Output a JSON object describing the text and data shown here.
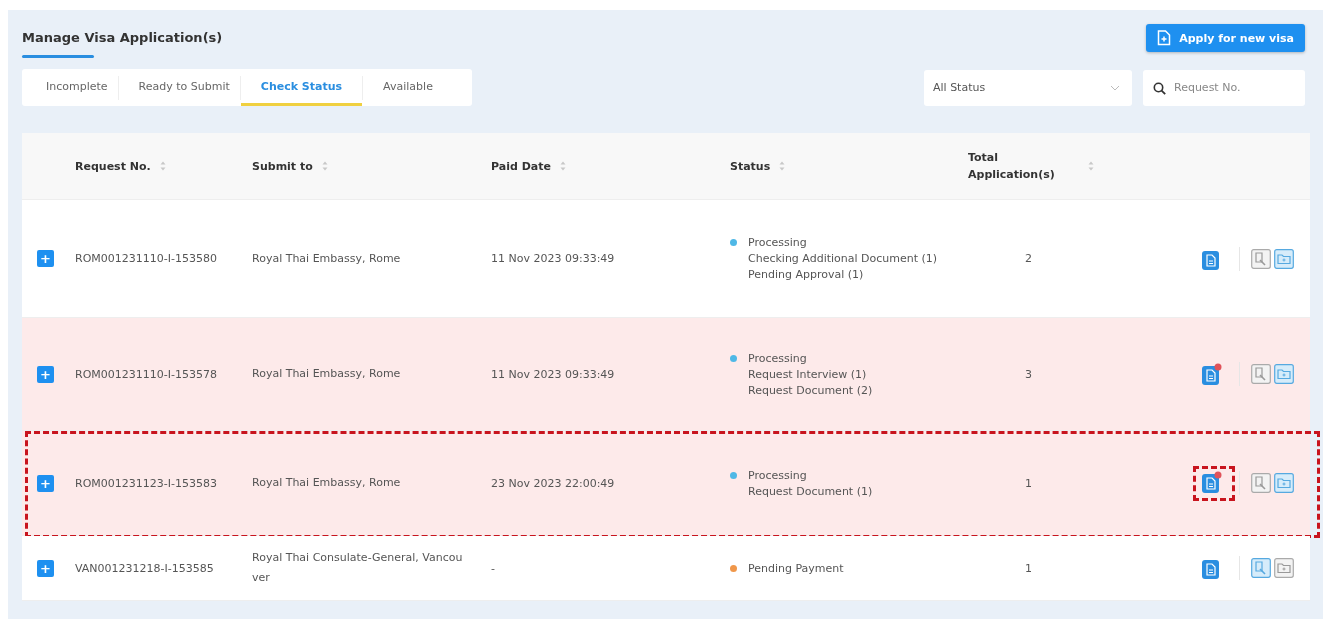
{
  "page_title": "Manage Visa Application(s)",
  "apply_button": "Apply for new visa",
  "tabs": [
    {
      "label": "Incomplete",
      "selected": false
    },
    {
      "label": "Ready to Submit",
      "selected": false
    },
    {
      "label": "Check Status",
      "selected": true
    },
    {
      "label": "Available",
      "selected": false
    }
  ],
  "status_filter": {
    "value": "All Status"
  },
  "search": {
    "placeholder": "Request No."
  },
  "table": {
    "columns": [
      "Request No.",
      "Submit to",
      "Paid Date",
      "Status",
      "Total Application(s)"
    ],
    "rows": [
      {
        "expand": "+",
        "request_no": "ROM001231110-I-153580",
        "submit_to": "Royal Thai Embassy, Rome",
        "paid_date": "11 Nov 2023 09:33:49",
        "status": {
          "label": "Processing",
          "color": "#4fb8e6",
          "details": [
            "Checking Additional Document (1)",
            "Pending Approval (1)"
          ]
        },
        "total": "2",
        "alert": false,
        "annotated": false,
        "interview_enabled": false,
        "folder_enabled": true
      },
      {
        "expand": "+",
        "request_no": "ROM001231110-I-153578",
        "submit_to": "Royal Thai Embassy, Rome",
        "paid_date": "11 Nov 2023 09:33:49",
        "status": {
          "label": "Processing",
          "color": "#4fb8e6",
          "details": [
            "Request Interview (1)",
            "Request Document (2)"
          ]
        },
        "total": "3",
        "alert": true,
        "annotated": false,
        "interview_enabled": false,
        "folder_enabled": true
      },
      {
        "expand": "+",
        "request_no": "ROM001231123-I-153583",
        "submit_to": "Royal Thai Embassy, Rome",
        "paid_date": "23 Nov 2023 22:00:49",
        "status": {
          "label": "Processing",
          "color": "#4fb8e6",
          "details": [
            "Request Document (1)"
          ]
        },
        "total": "1",
        "alert": true,
        "annotated": true,
        "interview_enabled": false,
        "folder_enabled": true
      },
      {
        "expand": "+",
        "request_no": "VAN001231218-I-153585",
        "submit_to": "Royal Thai Consulate-General, Vancouver",
        "paid_date": "-",
        "status": {
          "label": "Pending Payment",
          "color": "#f0974a"
        },
        "total": "1",
        "alert": false,
        "annotated": false,
        "interview_enabled": true,
        "folder_enabled": false
      }
    ]
  }
}
